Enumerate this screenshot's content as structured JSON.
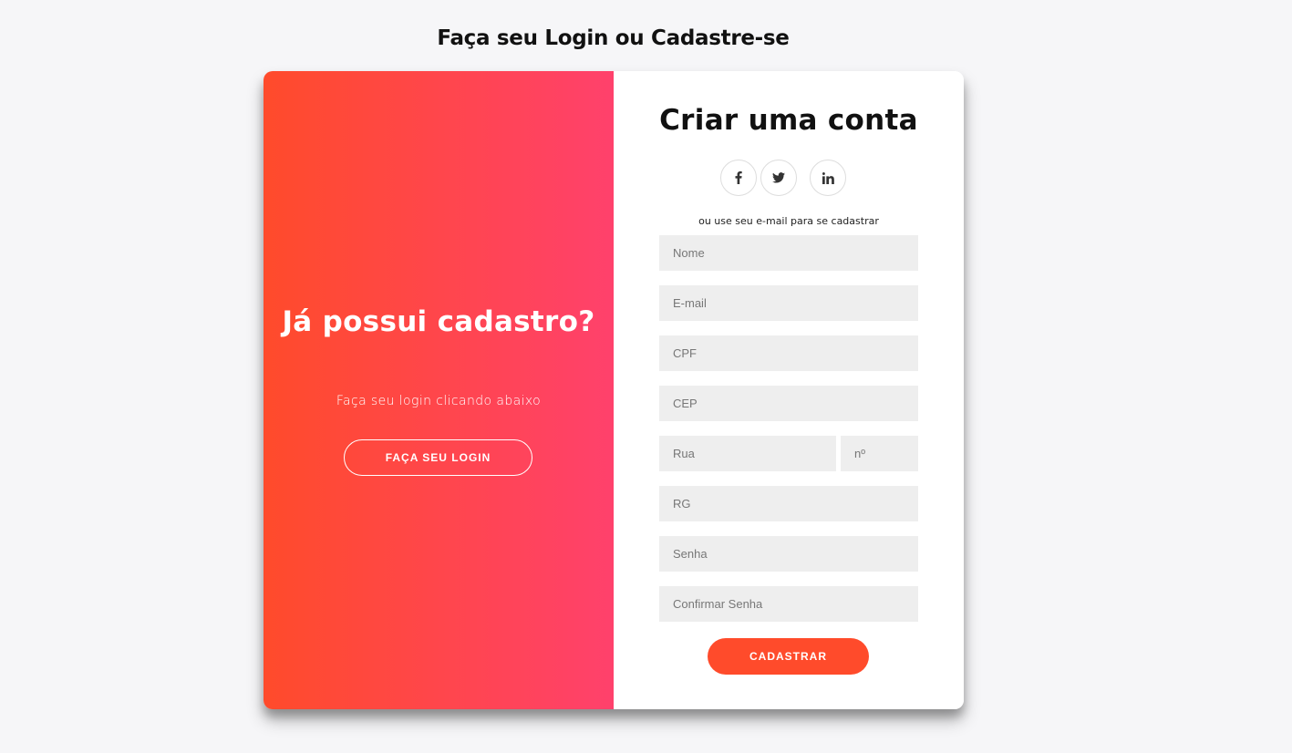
{
  "page": {
    "title": "Faça seu Login ou Cadastre-se"
  },
  "overlay": {
    "heading": "Já possui cadastro?",
    "text": "Faça seu login clicando abaixo",
    "button_label": "Faça seu login",
    "gradient": [
      "#ff4b2b",
      "#ff416c"
    ]
  },
  "signup": {
    "title": "Criar uma conta",
    "social": [
      {
        "icon": "facebook-icon"
      },
      {
        "icon": "twitter-icon"
      },
      {
        "icon": "linkedin-icon"
      }
    ],
    "social_text": "ou use seu e-mail para se cadastrar",
    "fields": {
      "nome": {
        "placeholder": "Nome",
        "value": ""
      },
      "email": {
        "placeholder": "E-mail",
        "value": ""
      },
      "cpf": {
        "placeholder": "CPF",
        "value": ""
      },
      "cep": {
        "placeholder": "CEP",
        "value": ""
      },
      "rua": {
        "placeholder": "Rua",
        "value": ""
      },
      "numero": {
        "placeholder": "nº",
        "value": ""
      },
      "rg": {
        "placeholder": "RG",
        "value": ""
      },
      "senha": {
        "placeholder": "Senha",
        "value": ""
      },
      "confirmar_senha": {
        "placeholder": "Confirmar Senha",
        "value": ""
      }
    },
    "submit_label": "Cadastrar",
    "accent": "#ff4b2b"
  }
}
